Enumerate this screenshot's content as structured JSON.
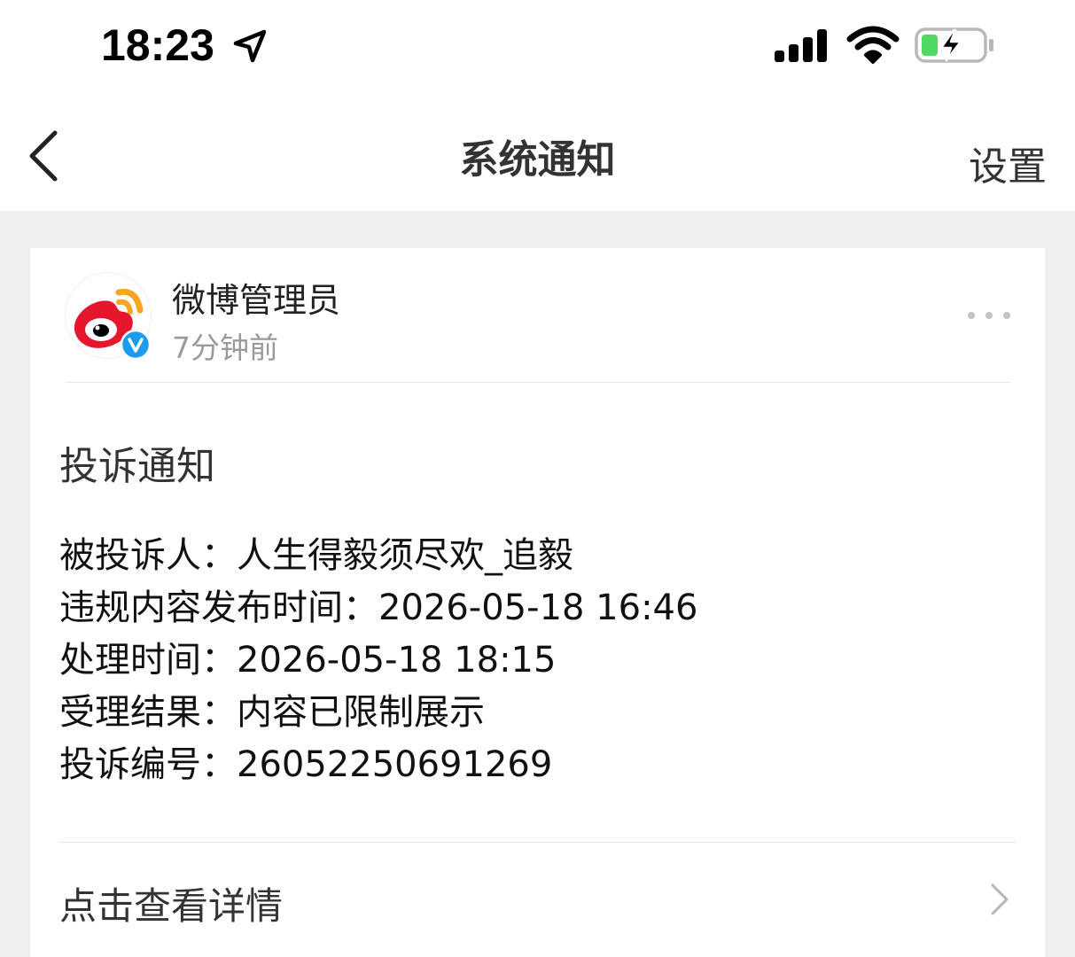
{
  "status_bar": {
    "time": "18:23",
    "icons": [
      "location-arrow-icon",
      "cellular-signal-icon",
      "wifi-icon",
      "battery-charging-icon"
    ]
  },
  "nav": {
    "title": "系统通知",
    "settings_label": "设置",
    "back_icon": "chevron-left-icon"
  },
  "message": {
    "sender": "微博管理员",
    "time_ago": "7分钟前",
    "avatar_icon": "weibo-logo-icon",
    "badge_icon": "verified-v-icon",
    "more_icon": "more-dots-icon",
    "title": "投诉通知",
    "details": [
      {
        "label": "被投诉人：",
        "value": "人生得毅须尽欢_追毅"
      },
      {
        "label": "违规内容发布时间：",
        "value": "2026-05-18 16:46"
      },
      {
        "label": "处理时间：",
        "value": "2026-05-18 18:15"
      },
      {
        "label": "受理结果：",
        "value": "内容已限制展示"
      },
      {
        "label": "投诉编号：",
        "value": "26052250691269"
      }
    ],
    "detail_link_label": "点击查看详情"
  },
  "colors": {
    "background": "#efefef",
    "card": "#ffffff",
    "weibo_red": "#e6162d",
    "weibo_orange": "#f7a623",
    "verified_blue": "#1d9bf0",
    "battery_green": "#4cd964",
    "secondary_text": "#9a9a9a"
  }
}
